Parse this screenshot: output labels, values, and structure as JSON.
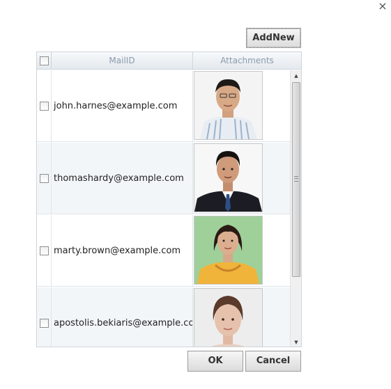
{
  "dialog": {
    "close_glyph": "×"
  },
  "toolbar": {
    "addnew_label": "AddNew"
  },
  "grid": {
    "columns": {
      "mail": "MailID",
      "attachments": "Attachments"
    },
    "rows": [
      {
        "mail": "john.harnes@example.com",
        "photo": "man-striped-shirt-portrait"
      },
      {
        "mail": "thomashardy@example.com",
        "photo": "man-suit-tie-portrait"
      },
      {
        "mail": "marty.brown@example.com",
        "photo": "woman-yellow-dress-portrait"
      },
      {
        "mail": "apostolis.bekiaris@example.com",
        "photo": "woman-portrait"
      }
    ]
  },
  "footer": {
    "ok_label": "OK",
    "cancel_label": "Cancel"
  },
  "colors": {
    "header_text": "#8a9aab",
    "alt_row": "#f3f6f9",
    "border": "#cdd5dc"
  }
}
